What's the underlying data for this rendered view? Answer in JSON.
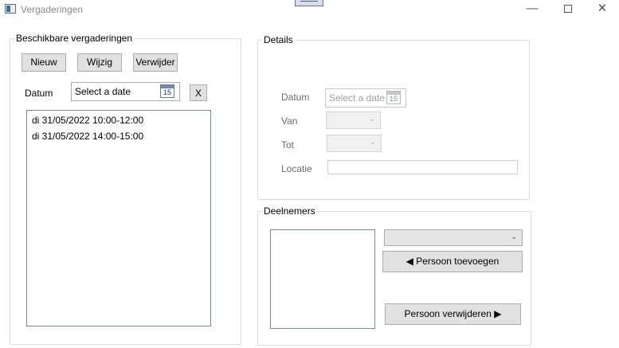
{
  "window": {
    "title": "Vergaderingen",
    "controls": {
      "minimize": "—",
      "close": "✕"
    }
  },
  "left_group": {
    "title": "Beschikbare vergaderingen",
    "buttons": {
      "new": "Nieuw",
      "edit": "Wijzig",
      "delete": "Verwijder"
    },
    "date_label": "Datum",
    "date_picker": {
      "placeholder": "Select a date",
      "calendar_day": "15"
    },
    "clear_button": "X",
    "meetings": [
      "di 31/05/2022 10:00-12:00",
      "di 31/05/2022 14:00-15:00"
    ]
  },
  "details_group": {
    "title": "Details",
    "date_label": "Datum",
    "date_picker": {
      "placeholder": "Select a date",
      "calendar_day": "15"
    },
    "from_label": "Van",
    "to_label": "Tot",
    "location_label": "Locatie",
    "combo_chevron": "⌄"
  },
  "participants_group": {
    "title": "Deelnemers",
    "add_button": "◀ Persoon toevoegen",
    "remove_button": "Persoon verwijderen ▶",
    "combo_chevron": "⌄"
  }
}
